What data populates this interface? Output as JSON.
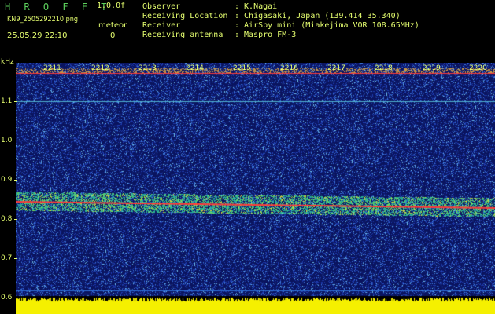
{
  "header": {
    "title": "H R O F F T",
    "version": "1.0.0f",
    "filename": "KN9_2505292210.png",
    "datetime": "25.05.29 22:10",
    "meteor_label": "meteor",
    "meteor_count": "0"
  },
  "info": [
    {
      "label": "Observer",
      "value": ": K.Nagai"
    },
    {
      "label": "Receiving Location",
      "value": ": Chigasaki, Japan (139.414 35.340)"
    },
    {
      "label": "Receiver",
      "value": ": AirSpy mini (Miakejima VOR 108.65MHz)"
    },
    {
      "label": "Receiving antenna",
      "value": ": Maspro FM-3"
    }
  ],
  "plot": {
    "y_unit": "kHz",
    "y_ticks": [
      "1.1",
      "1.0",
      "0.9",
      "0.8",
      "0.7",
      "0.6"
    ],
    "x_ticks": [
      "2211",
      "2212",
      "2213",
      "2214",
      "2215",
      "2216",
      "2217",
      "2218",
      "2219",
      "2220"
    ],
    "colors": {
      "background": "#0b1a66",
      "signal": "#ff3a3a",
      "band": "#2fd08a",
      "noise_floor": "#f5f000",
      "text": "#e6ff70"
    }
  }
}
